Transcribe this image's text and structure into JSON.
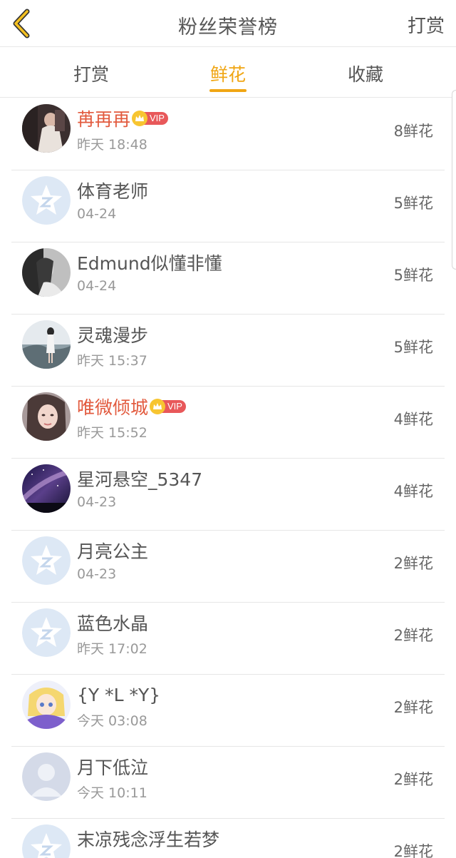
{
  "header": {
    "title": "粉丝荣誉榜",
    "action_label": "打赏",
    "back_icon": "chevron-left-icon"
  },
  "tabs": [
    {
      "label": "打赏",
      "active": false
    },
    {
      "label": "鲜花",
      "active": true
    },
    {
      "label": "收藏",
      "active": false
    }
  ],
  "colors": {
    "accent": "#f0a614",
    "vip_name": "#e25a3e",
    "vip_tag": "#e8585a",
    "crown": "#f7c531"
  },
  "vip_label": "VIP",
  "fans": [
    {
      "name": "苒再再",
      "vip": true,
      "time": "昨天 18:48",
      "count": "8鲜花",
      "avatar": "photo-avatar"
    },
    {
      "name": "体育老师",
      "vip": false,
      "time": "04-24",
      "count": "5鲜花",
      "avatar": "default-qq-avatar"
    },
    {
      "name": "Edmund似懂非懂",
      "vip": false,
      "time": "04-24",
      "count": "5鲜花",
      "avatar": "photo-avatar"
    },
    {
      "name": "灵魂漫步",
      "vip": false,
      "time": "昨天 15:37",
      "count": "5鲜花",
      "avatar": "photo-avatar"
    },
    {
      "name": "唯微倾城",
      "vip": true,
      "time": "昨天 15:52",
      "count": "4鲜花",
      "avatar": "photo-avatar"
    },
    {
      "name": "星河悬空_5347",
      "vip": false,
      "time": "04-23",
      "count": "4鲜花",
      "avatar": "galaxy-avatar"
    },
    {
      "name": "月亮公主",
      "vip": false,
      "time": "04-23",
      "count": "2鲜花",
      "avatar": "default-qq-avatar"
    },
    {
      "name": "蓝色水晶",
      "vip": false,
      "time": "昨天 17:02",
      "count": "2鲜花",
      "avatar": "default-qq-avatar"
    },
    {
      "name": "{Y *L *Y}",
      "vip": false,
      "time": "今天 03:08",
      "count": "2鲜花",
      "avatar": "anime-avatar"
    },
    {
      "name": "月下低泣",
      "vip": false,
      "time": "今天 10:11",
      "count": "2鲜花",
      "avatar": "default-person-avatar"
    },
    {
      "name": "末凉残念浮生若梦",
      "vip": false,
      "time": "",
      "count": "2鲜花",
      "avatar": "default-qq-avatar"
    }
  ]
}
